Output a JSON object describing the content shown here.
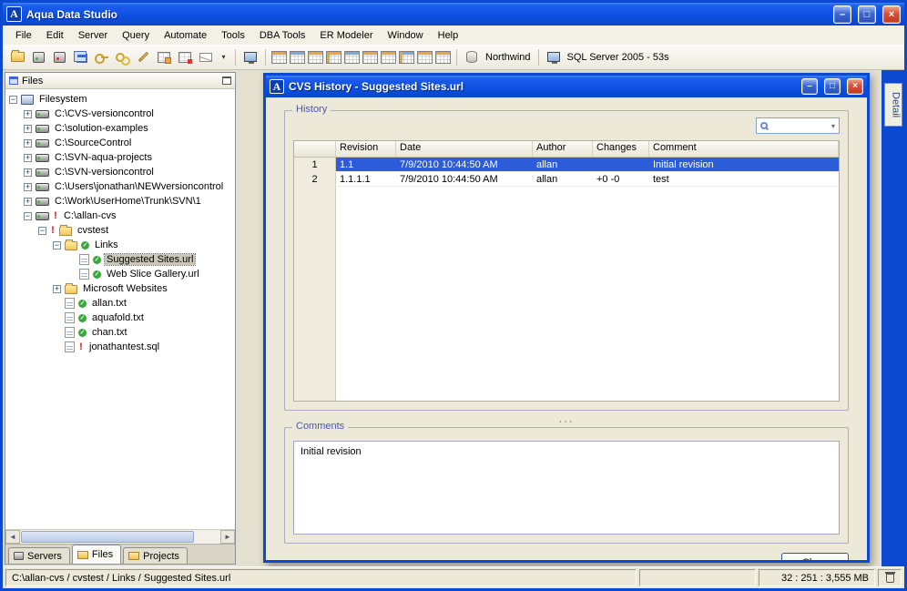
{
  "icons": {
    "app_logo": "A",
    "minimize": "–",
    "maximize": "□",
    "close": "×",
    "expand": "+",
    "collapse": "−",
    "dropdown": "▾",
    "check": "✓",
    "exclamation": "!",
    "scroll_left": "◄",
    "scroll_right": "►"
  },
  "titlebar": {
    "title": "Aqua Data Studio"
  },
  "menu": {
    "items": [
      "File",
      "Edit",
      "Server",
      "Query",
      "Automate",
      "Tools",
      "DBA Tools",
      "ER Modeler",
      "Window",
      "Help"
    ]
  },
  "toolbar": {
    "database": "Northwind",
    "server": "SQL Server 2005 - 53s"
  },
  "files_panel": {
    "title": "Files",
    "tree": [
      {
        "label": "Filesystem",
        "type": "computer",
        "state": "expanded"
      },
      {
        "label": "C:\\CVS-versioncontrol",
        "type": "drive",
        "state": "collapsed"
      },
      {
        "label": "C:\\solution-examples",
        "type": "drive",
        "state": "collapsed"
      },
      {
        "label": "C:\\SourceControl",
        "type": "drive",
        "state": "collapsed"
      },
      {
        "label": "C:\\SVN-aqua-projects",
        "type": "drive",
        "state": "collapsed"
      },
      {
        "label": "C:\\SVN-versioncontrol",
        "type": "drive",
        "state": "collapsed"
      },
      {
        "label": "C:\\Users\\jonathan\\NEWversioncontrol",
        "type": "drive",
        "state": "collapsed"
      },
      {
        "label": "C:\\Work\\UserHome\\Trunk\\SVN\\1",
        "type": "drive",
        "state": "collapsed"
      },
      {
        "label": "C:\\allan-cvs",
        "type": "drive",
        "state": "expanded",
        "status": "modified"
      },
      {
        "label": "cvstest",
        "type": "folder",
        "state": "expanded",
        "status": "modified"
      },
      {
        "label": "Links",
        "type": "folder",
        "state": "expanded",
        "status": "ok"
      },
      {
        "label": "Suggested Sites.url",
        "type": "file",
        "status": "ok",
        "selected": true
      },
      {
        "label": "Web Slice Gallery.url",
        "type": "file",
        "status": "ok"
      },
      {
        "label": "Microsoft Websites",
        "type": "folder",
        "state": "collapsed"
      },
      {
        "label": "allan.txt",
        "type": "file",
        "status": "ok"
      },
      {
        "label": "aquafold.txt",
        "type": "file",
        "status": "ok"
      },
      {
        "label": "chan.txt",
        "type": "file",
        "status": "ok"
      },
      {
        "label": "jonathantest.sql",
        "type": "file",
        "status": "modified"
      }
    ],
    "tabs": [
      {
        "label": "Servers"
      },
      {
        "label": "Files",
        "active": true
      },
      {
        "label": "Projects"
      }
    ]
  },
  "detail_tab": {
    "label": "Detail"
  },
  "dialog": {
    "title": "CVS History - Suggested Sites.url",
    "history": {
      "label": "History"
    },
    "table": {
      "columns": [
        "Revision",
        "Date",
        "Author",
        "Changes",
        "Comment"
      ],
      "rows": [
        {
          "num": "1",
          "revision": "1.1",
          "date": "7/9/2010 10:44:50 AM",
          "author": "allan",
          "changes": "",
          "comment": "Initial revision",
          "selected": true
        },
        {
          "num": "2",
          "revision": "1.1.1.1",
          "date": "7/9/2010 10:44:50 AM",
          "author": "allan",
          "changes": "+0 -0",
          "comment": "test",
          "selected": false
        }
      ]
    },
    "splitter": "···",
    "comments": {
      "label": "Comments",
      "text": "Initial revision"
    },
    "close_label": "Close"
  },
  "statusbar": {
    "path": "C:\\allan-cvs / cvstest / Links / Suggested Sites.url",
    "stats": "32 : 251 : 3,555 MB"
  }
}
